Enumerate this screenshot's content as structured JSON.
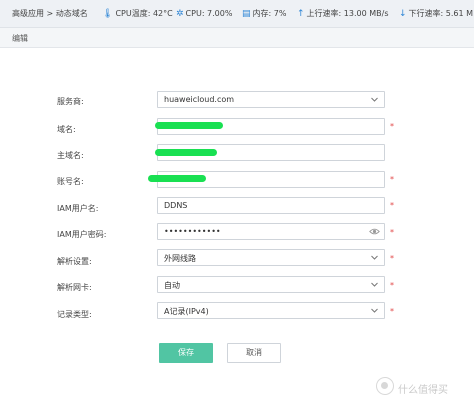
{
  "topbar": {
    "breadcrumb": "高级应用 > 动态域名",
    "cpu_temp": "CPU温度: 42°C",
    "cpu": "CPU: 7.00%",
    "memory": "内存: 7%",
    "upload": "上行速率: 13.00 MB/s",
    "download": "下行速率: 5.61 M"
  },
  "header": {
    "title": "编辑"
  },
  "form": {
    "provider": {
      "label": "服务商:",
      "value": "huaweicloud.com"
    },
    "domain": {
      "label": "域名:",
      "value": ""
    },
    "main_domain": {
      "label": "主域名:",
      "value": ""
    },
    "account": {
      "label": "账号名:",
      "value": ""
    },
    "iam_user": {
      "label": "IAM用户名:",
      "value": "DDNS"
    },
    "iam_password": {
      "label": "IAM用户密码:",
      "value": "••••••••••••"
    },
    "resolve_setting": {
      "label": "解析设置:",
      "value": "外网线路"
    },
    "resolve_nic": {
      "label": "解析网卡:",
      "value": "自动"
    },
    "record_type": {
      "label": "记录类型:",
      "value": "A记录(IPv4)"
    },
    "required_mark": "*"
  },
  "buttons": {
    "save": "保存",
    "cancel": "取消"
  },
  "watermark": {
    "text": "什么值得买"
  },
  "colors": {
    "accent": "#51c5a3",
    "required": "#e24a4a",
    "icon": "#2f86d6",
    "redaction": "#19e052"
  }
}
